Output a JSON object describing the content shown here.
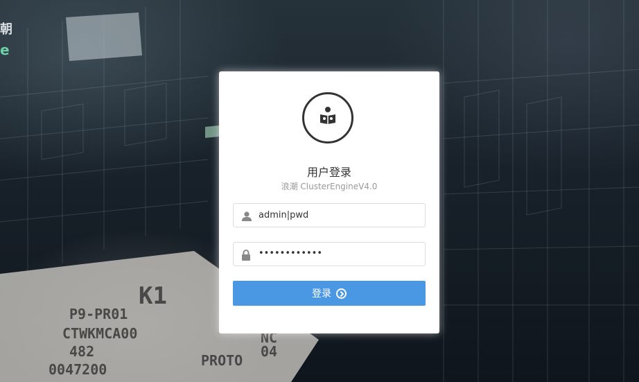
{
  "brand": {
    "top_char": "朝",
    "bottom_char": "e"
  },
  "background": {
    "chip_lines": [
      "P9-PR01",
      "CTWKMCA00",
      "482",
      "0047200"
    ],
    "chip_logo": "K1",
    "chip_side": [
      "NC",
      "04",
      "PROTO"
    ]
  },
  "login": {
    "title": "用户登录",
    "subtitle": "浪潮 ClusterEngineV4.0",
    "username_value": "admin|pwd",
    "password_value": "••••••••••••",
    "submit_label": "登录"
  },
  "colors": {
    "accent": "#4a97e3",
    "brand_green": "#6fd0a8"
  },
  "icons": {
    "avatar": "user-reading-icon",
    "user": "user-icon",
    "lock": "lock-icon",
    "submit": "arrow-circle-right-icon"
  }
}
